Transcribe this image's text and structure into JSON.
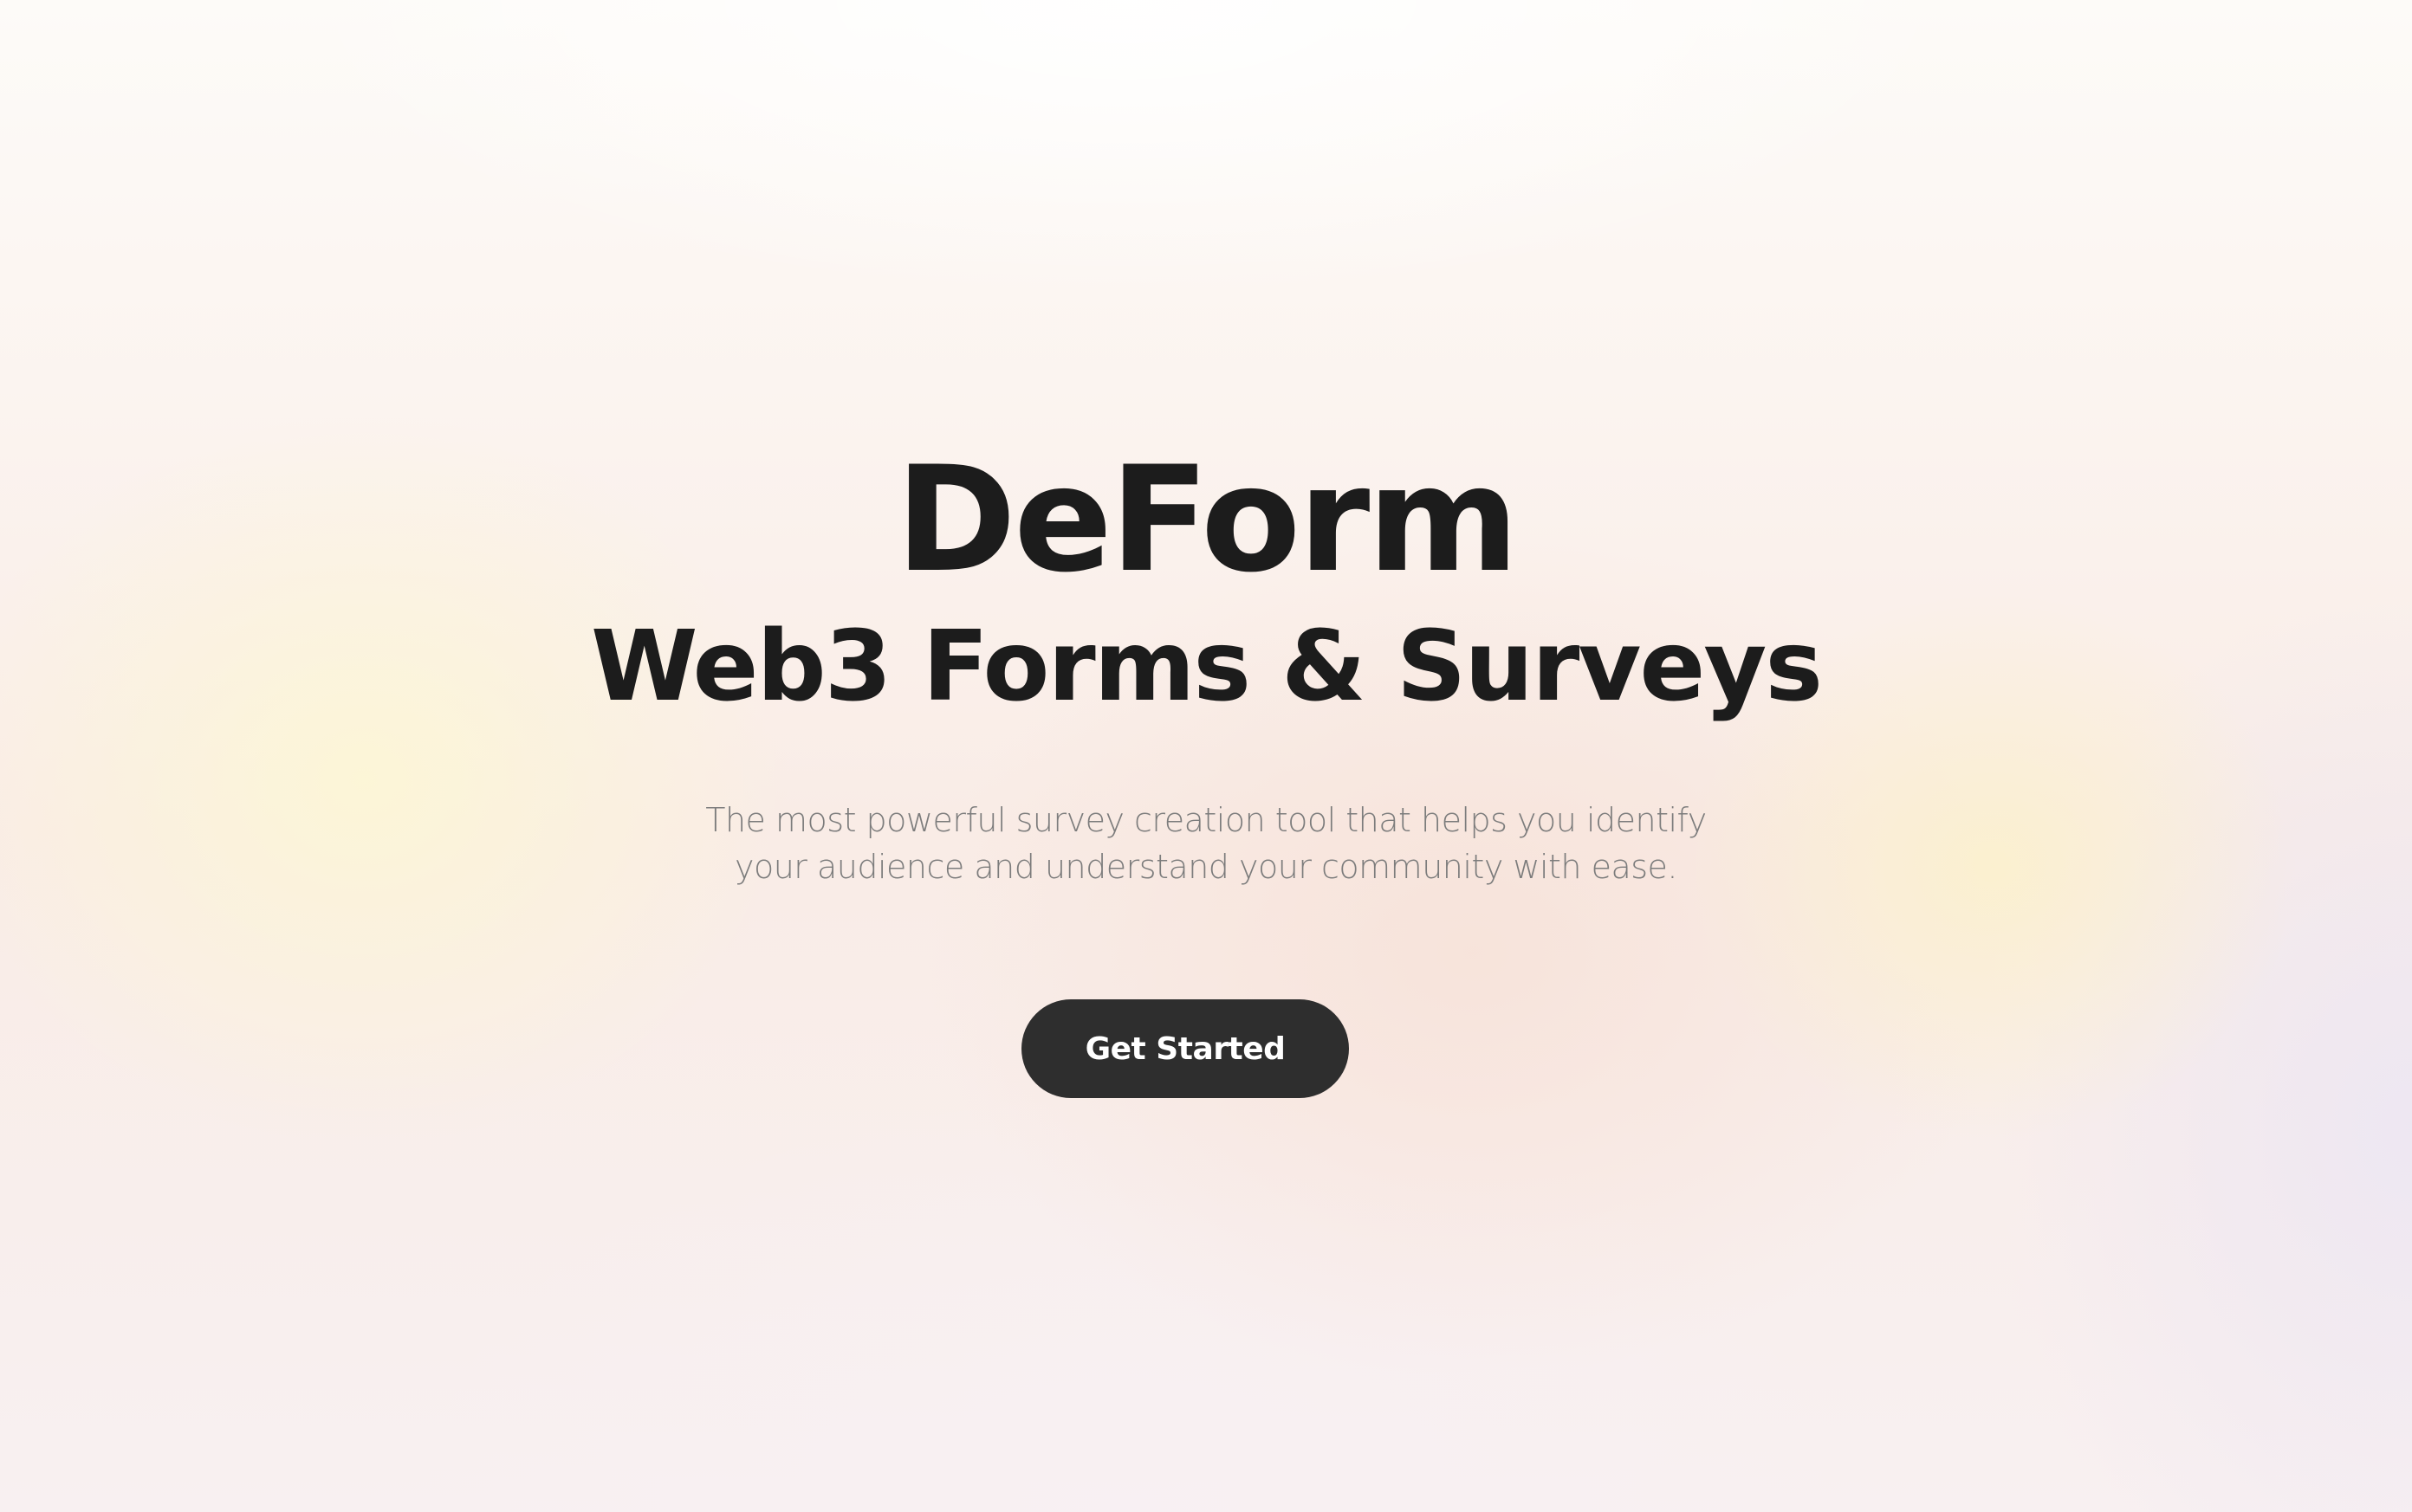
{
  "hero": {
    "title": "DeForm",
    "subtitle": "Web3 Forms & Surveys",
    "description_line1": "The most powerful survey creation tool that helps you identify",
    "description_line2": "your audience and understand your community with ease.",
    "cta_label": "Get Started"
  },
  "colors": {
    "text_primary": "#1c1c1c",
    "text_secondary": "#7c7c7c",
    "button_bg": "#2e2e2e",
    "button_text": "#ffffff"
  }
}
